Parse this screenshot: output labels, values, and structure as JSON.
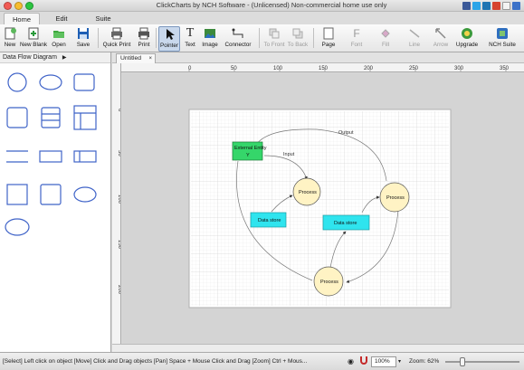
{
  "window": {
    "title": "ClickCharts by NCH Software - (Unlicensed) Non-commercial home use only"
  },
  "menu_tabs": [
    "Home",
    "Edit",
    "Suite"
  ],
  "toolbar": [
    {
      "label": "New",
      "icon": "new-icon"
    },
    {
      "label": "New Blank",
      "icon": "new-blank-icon"
    },
    {
      "label": "Open",
      "icon": "open-folder-icon"
    },
    {
      "label": "Save",
      "icon": "save-icon"
    },
    {
      "label": "Quick Print",
      "icon": "quick-print-icon"
    },
    {
      "label": "Print",
      "icon": "print-icon"
    },
    {
      "label": "Pointer",
      "icon": "pointer-icon"
    },
    {
      "label": "Text",
      "icon": "text-icon"
    },
    {
      "label": "Image",
      "icon": "image-icon"
    },
    {
      "label": "Connector",
      "icon": "connector-icon"
    },
    {
      "label": "To Front",
      "icon": "to-front-icon"
    },
    {
      "label": "To Back",
      "icon": "to-back-icon"
    },
    {
      "label": "Page",
      "icon": "page-icon"
    },
    {
      "label": "Font",
      "icon": "font-icon"
    },
    {
      "label": "Fill",
      "icon": "fill-icon"
    },
    {
      "label": "Line",
      "icon": "line-icon"
    },
    {
      "label": "Arrow",
      "icon": "arrow-icon"
    },
    {
      "label": "Upgrade",
      "icon": "upgrade-icon"
    },
    {
      "label": "NCH Suite",
      "icon": "nch-suite-icon"
    }
  ],
  "left_panel": {
    "header": "Data Flow Diagram",
    "header_arrow": "▶"
  },
  "document_tab": {
    "label": "Untitled",
    "close": "×"
  },
  "rulers": {
    "horizontal": [
      "0",
      "50",
      "100",
      "150",
      "200",
      "250",
      "300",
      "350"
    ],
    "vertical": [
      "0",
      "50",
      "100",
      "150",
      "200"
    ]
  },
  "diagram": {
    "external_entity": "External Entity",
    "external_entity_sub": "Y",
    "process_1": "Process",
    "process_2": "Process",
    "process_3": "Process",
    "datastore_1": "Data store",
    "datastore_2": "Data store",
    "label_input": "Input",
    "label_output": "Output"
  },
  "status_bar": {
    "text": "[Select] Left click on object  [Move] Click and Drag objects  [Pan] Space + Mouse Click and Drag  [Zoom] Ctrl + Mous...",
    "zoom_value": "100%",
    "zoom_label": "Zoom: 62%"
  },
  "colors": {
    "entity_fill": "#35d66a",
    "process_fill": "#fff3c4",
    "datastore_fill": "#2fe4ee",
    "selection_blue": "#c9d8ec"
  }
}
